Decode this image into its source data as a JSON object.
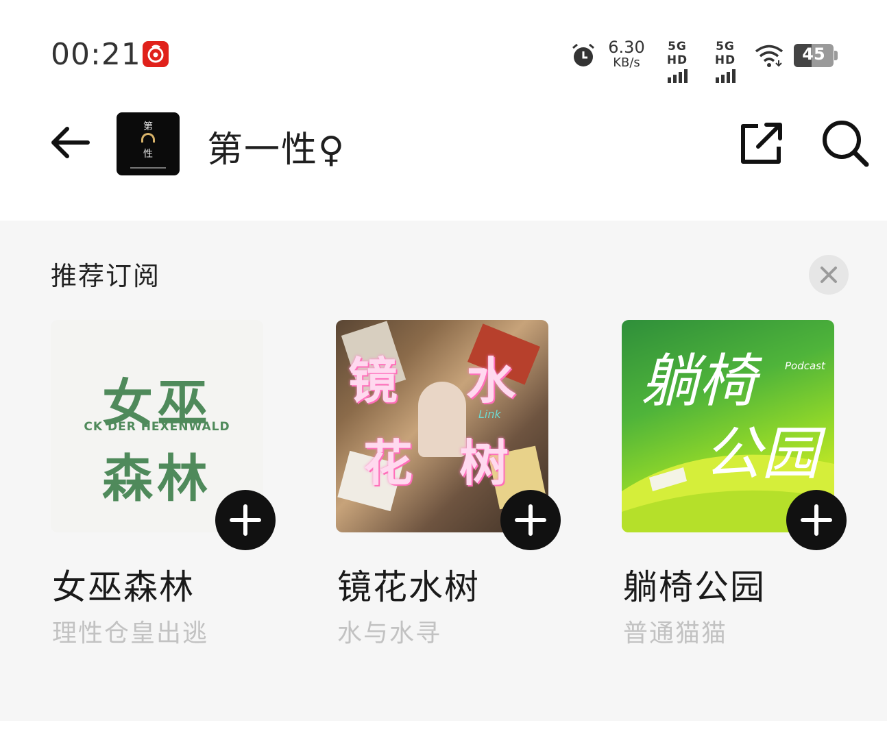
{
  "status_bar": {
    "time": "00:21",
    "netspeed_value": "6.30",
    "netspeed_unit": "KB/s",
    "signal_1_label": "5G HD",
    "signal_2_label": "5G HD",
    "battery": "45",
    "battery_level": 0.45,
    "icons": [
      "netease-music-icon",
      "alarm-icon",
      "signal-icon",
      "signal-icon",
      "wifi-icon",
      "battery-icon"
    ]
  },
  "header": {
    "title": "第一性♀",
    "thumb_line1": "第",
    "thumb_line2": "性",
    "icons": [
      "back-arrow-icon",
      "share-icon",
      "search-icon"
    ]
  },
  "recommend": {
    "title": "推荐订阅",
    "cards": [
      {
        "title": "女巫森林",
        "author": "理性仓皇出逃",
        "cover_big_1": "女巫",
        "cover_small": "CK DER HEXENWALD",
        "cover_big_2": "森林"
      },
      {
        "title": "镜花水树",
        "author": "水与水寻",
        "cover_text_1": "镜",
        "cover_text_2": "水",
        "cover_text_3": "花",
        "cover_text_4": "树",
        "cover_small": "Link"
      },
      {
        "title": "躺椅公园",
        "author": "普通猫猫",
        "cover_text_1": "躺椅",
        "cover_text_2": "公园",
        "cover_small": "Podcast"
      }
    ]
  },
  "colors": {
    "accent_red": "#e0211b",
    "section_bg": "#f6f6f6",
    "author_gray": "#c2c2c2",
    "forest_green": "#4f8a5b"
  }
}
